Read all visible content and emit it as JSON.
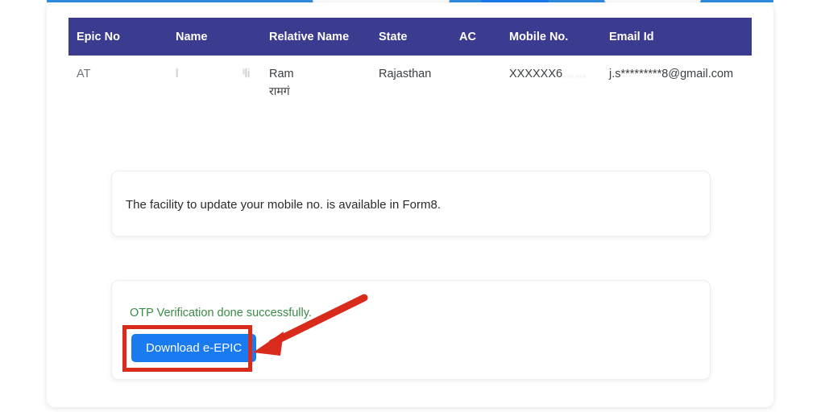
{
  "page": {
    "title_bar_color": "#2f8fe0",
    "header_color": "#3b3b8f",
    "accent_blue": "#1a7af0",
    "success_green": "#3a8a48",
    "annotation_red": "#d92b1c"
  },
  "table": {
    "columns": [
      "Epic No",
      "Name",
      "Relative Name",
      "State",
      "AC",
      "Mobile No.",
      "Email Id"
    ],
    "rows": [
      {
        "epic_no": "AT",
        "name_fragment_1": "l",
        "name_fragment_2": "ᴵli",
        "relative_name_en": "Ram",
        "relative_name_hi": "रामगं",
        "state": "Rajasthan",
        "ac": "",
        "mobile_no": "XXXXXX6",
        "mobile_no_faded": "……",
        "email_id": "j.s*********8@gmail.com"
      }
    ]
  },
  "notice": {
    "message": "The facility to update your mobile no. is available in Form8."
  },
  "otp": {
    "status_message": "OTP Verification done successfully.",
    "download_button_label": "Download e-EPIC"
  },
  "annotation": {
    "type": "arrow-and-box",
    "target": "Download e-EPIC"
  }
}
